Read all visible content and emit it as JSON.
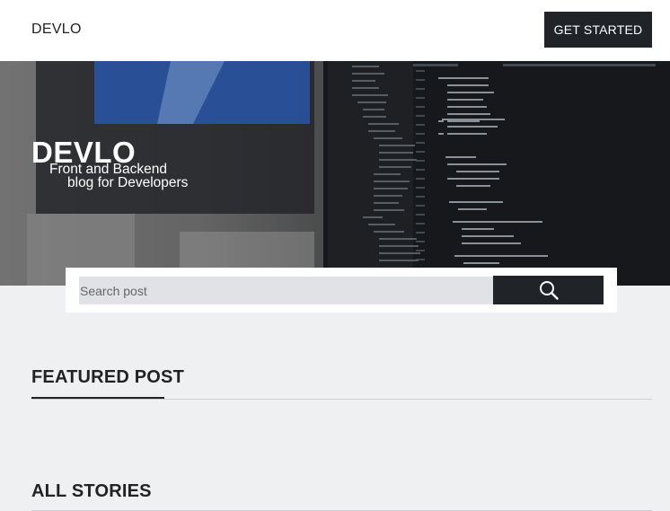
{
  "header": {
    "brand": "DEVLO",
    "cta_label": "GET STARTED"
  },
  "hero": {
    "title": "DEVLO",
    "subtitle_line1": "Front and Backend",
    "subtitle_line2": "blog for Developers"
  },
  "search": {
    "placeholder": "Search post",
    "button_icon": "search-icon"
  },
  "sections": {
    "featured": "FEATURED POST",
    "stories": "ALL STORIES"
  },
  "colors": {
    "dark": "#202328",
    "page_bg": "#eff0f2",
    "input_bg": "#e1e2e5"
  }
}
